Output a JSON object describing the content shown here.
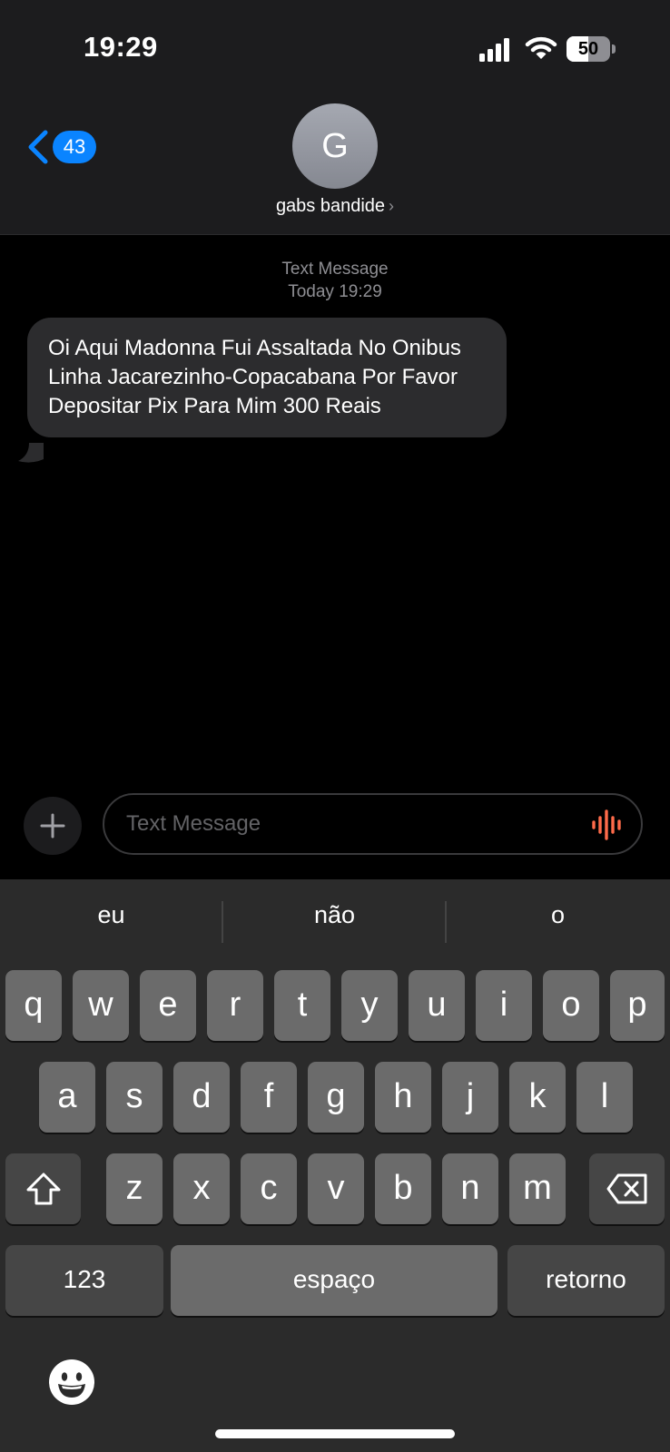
{
  "status_bar": {
    "time": "19:29",
    "battery_percent": "50",
    "battery_level": 0.5,
    "icons": [
      "signal-icon",
      "wifi-icon",
      "battery-icon"
    ]
  },
  "header": {
    "back_badge": "43",
    "avatar_initial": "G",
    "contact_name": "gabs bandide",
    "chevron": "›"
  },
  "conversation": {
    "meta_type": "Text Message",
    "meta_time": "Today 19:29",
    "message_text": "Oi Aqui  Madonna Fui Assaltada No Onibus Linha Jacarezinho-Copacabana Por Favor Depositar Pix Para Mim 300 Reais"
  },
  "composer": {
    "placeholder": "Text Message",
    "value": "",
    "mic_color": "#ff6b4a"
  },
  "keyboard": {
    "suggestions": [
      "eu",
      "não",
      "o"
    ],
    "row1": [
      "q",
      "w",
      "e",
      "r",
      "t",
      "y",
      "u",
      "i",
      "o",
      "p"
    ],
    "row2": [
      "a",
      "s",
      "d",
      "f",
      "g",
      "h",
      "j",
      "k",
      "l"
    ],
    "row3": [
      "z",
      "x",
      "c",
      "v",
      "b",
      "n",
      "m"
    ],
    "numbers_label": "123",
    "space_label": "espaço",
    "return_label": "retorno"
  },
  "colors": {
    "accent": "#0a84ff",
    "bubble": "#2c2c2e",
    "header_bg": "#1c1c1e",
    "keyboard_bg": "#2b2b2b"
  }
}
